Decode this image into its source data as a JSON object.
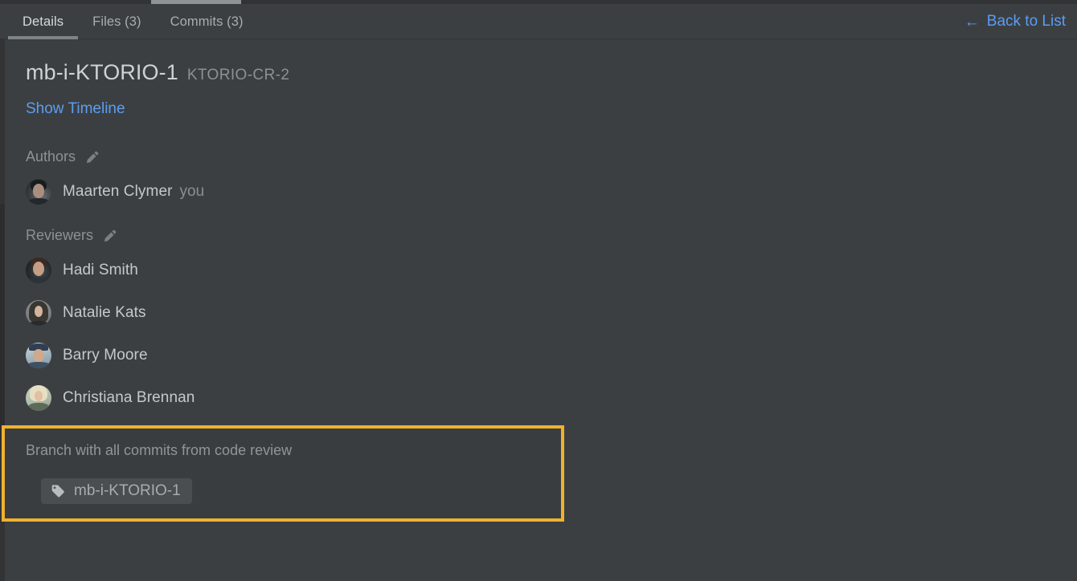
{
  "window": {
    "background_color": "#3c3f41",
    "accent_blue": "#5b9ef2",
    "highlight_color": "#efb12e"
  },
  "tabs": [
    {
      "label": "Details",
      "active": true
    },
    {
      "label": "Files (3)",
      "active": false
    },
    {
      "label": "Commits (3)",
      "active": false
    }
  ],
  "header": {
    "back_label": "Back to List",
    "back_arrow": "←",
    "back_icon_name": "arrow-left-icon"
  },
  "review": {
    "title": "mb-i-KTORIO-1",
    "subtitle": "KTORIO-CR-2",
    "timeline_link": "Show Timeline"
  },
  "authors": {
    "section_label": "Authors",
    "edit_icon": "pencil-icon",
    "people": [
      {
        "name": "Maarten Clymer",
        "badge": "you",
        "avatar_class": "av-maarten"
      }
    ]
  },
  "reviewers": {
    "section_label": "Reviewers",
    "edit_icon": "pencil-icon",
    "people": [
      {
        "name": "Hadi Smith",
        "badge": "",
        "avatar_class": "av-hadi"
      },
      {
        "name": "Natalie Kats",
        "badge": "",
        "avatar_class": "av-natalie"
      },
      {
        "name": "Barry Moore",
        "badge": "",
        "avatar_class": "av-barry"
      },
      {
        "name": "Christiana Brennan",
        "badge": "",
        "avatar_class": "av-christiana"
      }
    ]
  },
  "branch": {
    "label": "Branch with all commits from code review",
    "chip_label": "mb-i-KTORIO-1",
    "chip_icon": "tag-icon",
    "highlighted": true
  }
}
